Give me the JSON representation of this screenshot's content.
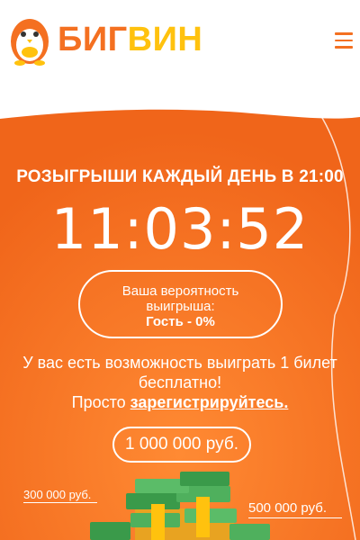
{
  "header": {
    "logo_part1": "БИГ",
    "logo_part2": "ВИН",
    "icons": {
      "logo": "penguin-mascot-icon",
      "menu": "hamburger-menu-icon"
    }
  },
  "hero": {
    "title": "РОЗЫГРЫШИ КАЖДЫЙ ДЕНЬ В 21:00",
    "timer": "11:03:52",
    "chance_line1": "Ваша вероятность",
    "chance_line2": "выигрыша:",
    "chance_value": "Гость - 0%",
    "offer_line1": "У вас есть возможность выиграть 1 билет",
    "offer_line2": "бесплатно!",
    "offer_prefix": "Просто ",
    "offer_link": "зарегистрируйтесь.",
    "jackpot": "1 000 000 руб.",
    "prize_left": "300 000 руб.",
    "prize_right": "500 000 руб."
  },
  "colors": {
    "brand_orange": "#f47021",
    "brand_yellow": "#ffc20e",
    "hero_orange": "#f26a1b",
    "money_green": "#3a9a4a"
  }
}
